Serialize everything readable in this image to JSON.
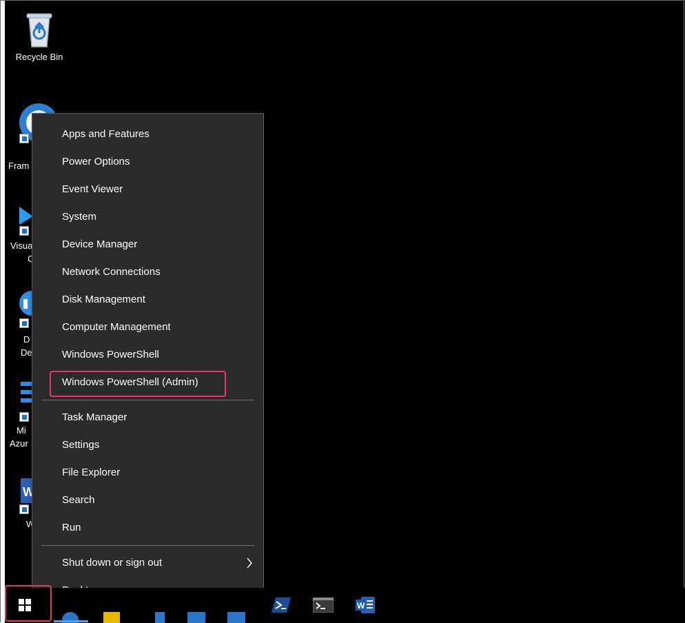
{
  "desktop": {
    "icons": [
      {
        "label": "Recycle Bin"
      },
      {
        "label": "Fram"
      },
      {
        "label_line1": "Visua",
        "label_line2": "C"
      },
      {
        "label_line1": "D",
        "label_line2": "De"
      },
      {
        "label_line1": "Mi",
        "label_line2": "Azur"
      },
      {
        "label": "W"
      }
    ]
  },
  "context_menu": {
    "group1": [
      "Apps and Features",
      "Power Options",
      "Event Viewer",
      "System",
      "Device Manager",
      "Network Connections",
      "Disk Management",
      "Computer Management",
      "Windows PowerShell",
      "Windows PowerShell (Admin)"
    ],
    "group2": [
      "Task Manager",
      "Settings",
      "File Explorer",
      "Search",
      "Run"
    ],
    "group3": [
      "Shut down or sign out",
      "Desktop"
    ]
  },
  "taskbar": {
    "icons": [
      "windows-start-icon",
      "powershell-icon",
      "terminal-icon",
      "word-icon"
    ]
  },
  "colors": {
    "highlight": "#e8356b",
    "menu_bg": "#2b2b2b",
    "desktop_bg": "#000000"
  }
}
